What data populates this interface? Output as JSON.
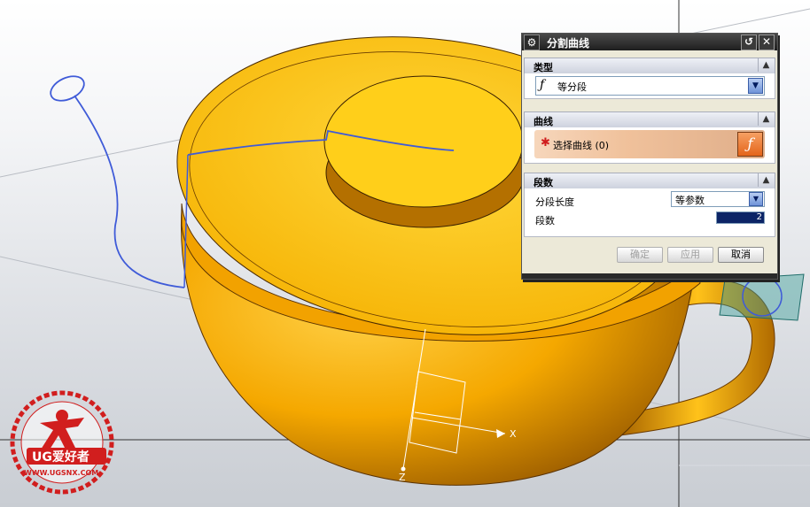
{
  "dialog": {
    "title": "分割曲线",
    "sections": {
      "type": {
        "label": "类型",
        "selected": "等分段"
      },
      "curve": {
        "label": "曲线",
        "select_text": "选择曲线 (0)"
      },
      "segments": {
        "label": "段数",
        "length_label": "分段长度",
        "length_value": "等参数",
        "count_label": "段数",
        "count_value": "2"
      }
    },
    "buttons": {
      "ok": "确定",
      "apply": "应用",
      "cancel": "取消"
    }
  },
  "viewport": {
    "axis_x_label": "X",
    "axis_z_label": "Z"
  },
  "watermark": {
    "brand": "UG爱好者",
    "url": "WWW.UGSNX.COM"
  },
  "colors": {
    "cup": "#f7b500",
    "curve": "#3f5bd8",
    "accent": "#e4641a"
  }
}
